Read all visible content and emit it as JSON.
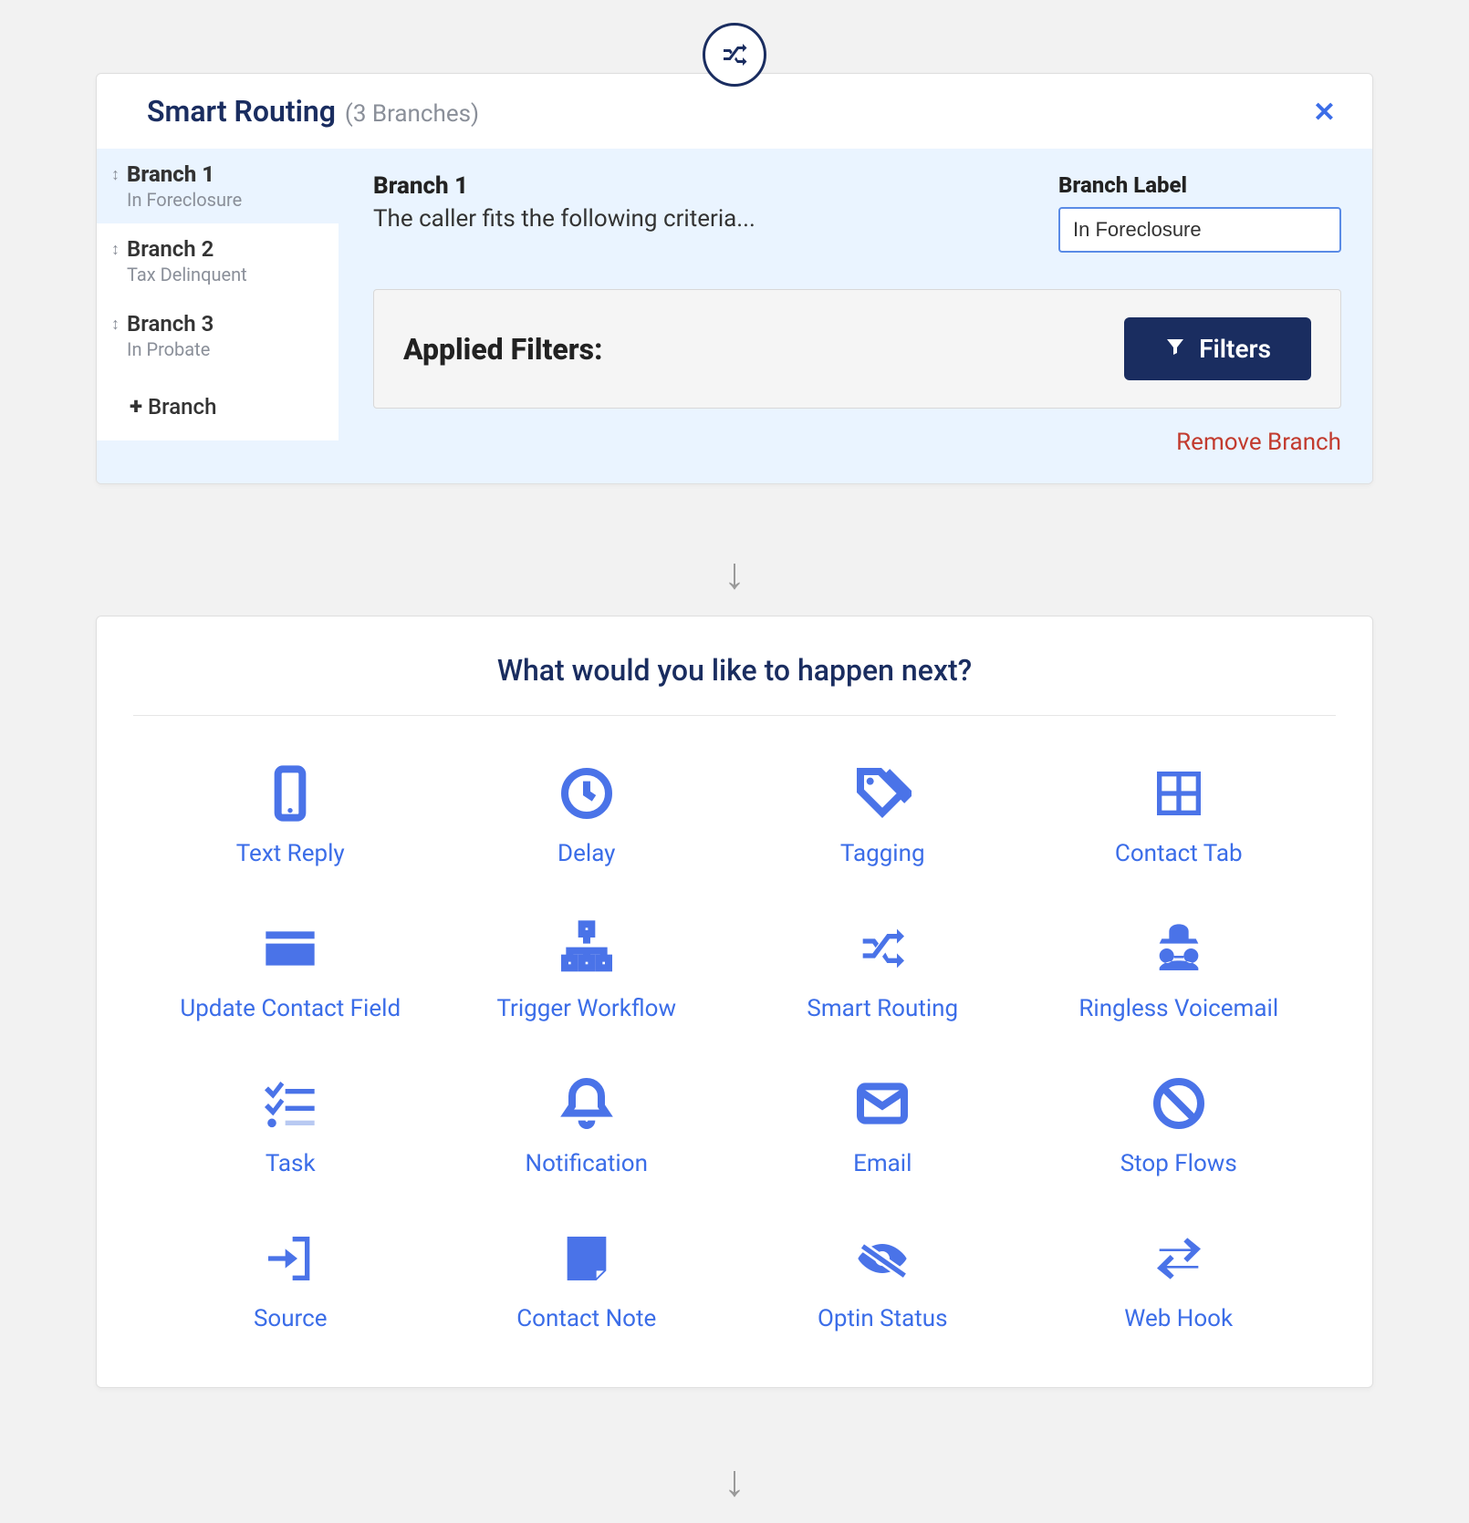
{
  "routing": {
    "title": "Smart Routing",
    "subtitle": "(3 Branches)",
    "branches": [
      {
        "name": "Branch 1",
        "sublabel": "In Foreclosure"
      },
      {
        "name": "Branch 2",
        "sublabel": "Tax Delinquent"
      },
      {
        "name": "Branch 3",
        "sublabel": "In Probate"
      }
    ],
    "add_branch_label": "Branch",
    "detail": {
      "title": "Branch 1",
      "desc": "The caller fits the following criteria...",
      "label_caption": "Branch Label",
      "label_value": "In Foreclosure",
      "filters_title": "Applied Filters:",
      "filters_btn": "Filters",
      "remove_link": "Remove Branch"
    }
  },
  "next": {
    "heading": "What would you like to happen next?",
    "actions": [
      {
        "label": "Text Reply"
      },
      {
        "label": "Delay"
      },
      {
        "label": "Tagging"
      },
      {
        "label": "Contact Tab"
      },
      {
        "label": "Update Contact Field"
      },
      {
        "label": "Trigger Workflow"
      },
      {
        "label": "Smart Routing"
      },
      {
        "label": "Ringless Voicemail"
      },
      {
        "label": "Task"
      },
      {
        "label": "Notification"
      },
      {
        "label": "Email"
      },
      {
        "label": "Stop Flows"
      },
      {
        "label": "Source"
      },
      {
        "label": "Contact Note"
      },
      {
        "label": "Optin Status"
      },
      {
        "label": "Web Hook"
      }
    ]
  }
}
